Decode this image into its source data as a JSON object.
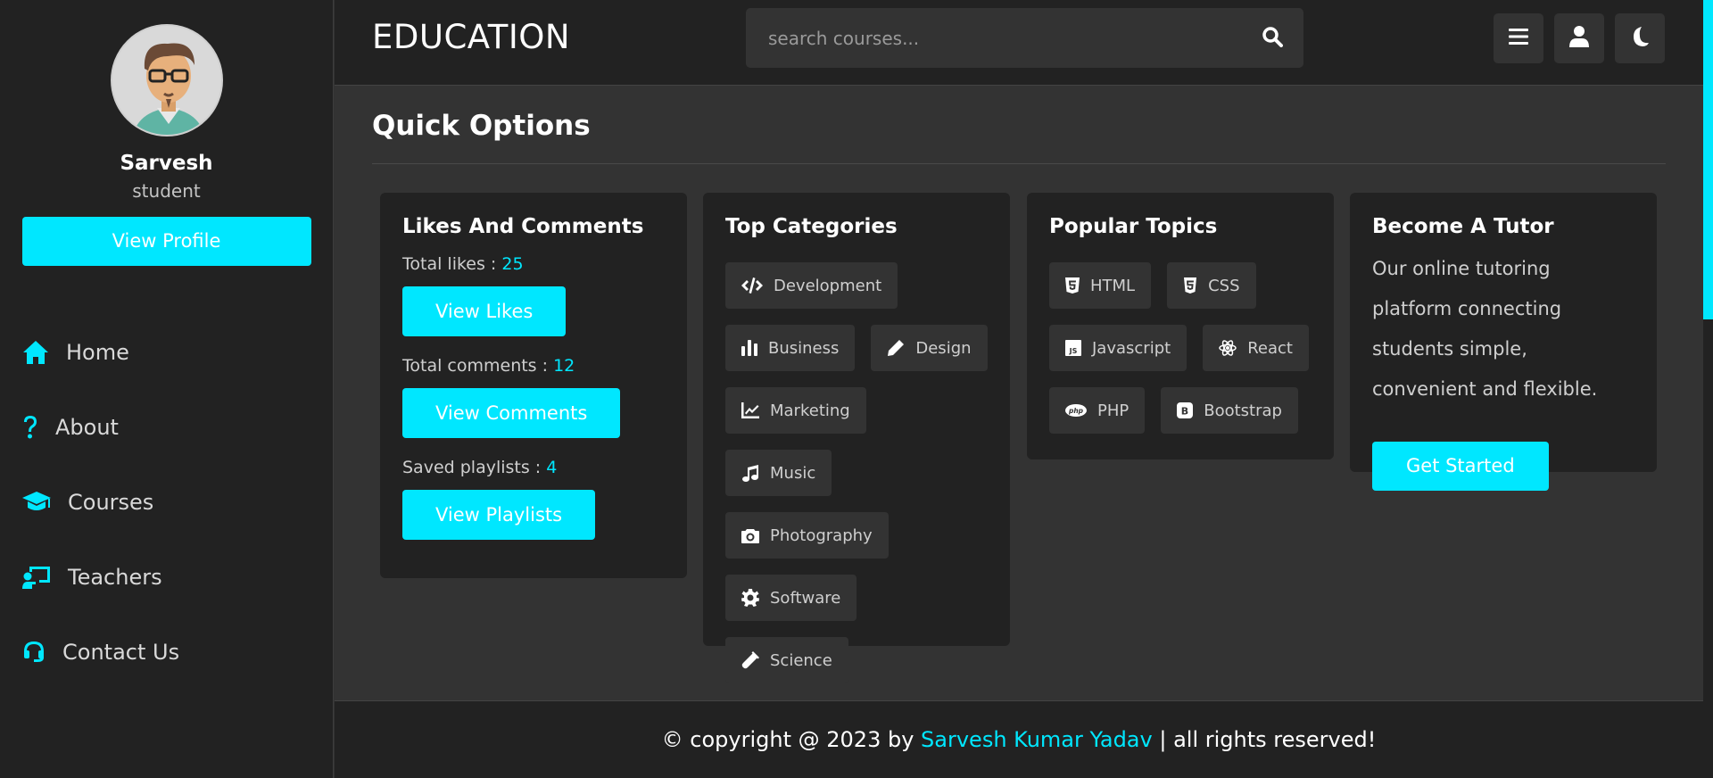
{
  "sidebar": {
    "profile": {
      "name": "Sarvesh",
      "role": "student",
      "button": "View Profile"
    },
    "nav": [
      {
        "label": "Home",
        "icon": "home-icon"
      },
      {
        "label": "About",
        "icon": "question-icon"
      },
      {
        "label": "Courses",
        "icon": "graduation-cap-icon"
      },
      {
        "label": "Teachers",
        "icon": "chalkboard-teacher-icon"
      },
      {
        "label": "Contact Us",
        "icon": "headset-icon"
      }
    ]
  },
  "header": {
    "logo": "EDUCATION",
    "search": {
      "placeholder": "search courses...",
      "icon": "search-icon"
    },
    "icons": [
      "menu-icon",
      "user-icon",
      "moon-icon"
    ]
  },
  "main": {
    "title": "Quick Options",
    "likes_card": {
      "title": "Likes And Comments",
      "likes_label": "Total likes : ",
      "likes_value": "25",
      "likes_button": "View Likes",
      "comments_label": "Total comments : ",
      "comments_value": "12",
      "comments_button": "View Comments",
      "playlists_label": "Saved playlists : ",
      "playlists_value": "4",
      "playlists_button": "View Playlists"
    },
    "categories_card": {
      "title": "Top Categories",
      "tags": [
        {
          "label": "Development",
          "icon": "code-icon"
        },
        {
          "label": "Business",
          "icon": "chart-bar-icon"
        },
        {
          "label": "Design",
          "icon": "pen-icon"
        },
        {
          "label": "Marketing",
          "icon": "chart-line-icon"
        },
        {
          "label": "Music",
          "icon": "music-icon"
        },
        {
          "label": "Photography",
          "icon": "camera-icon"
        },
        {
          "label": "Software",
          "icon": "cog-icon"
        },
        {
          "label": "Science",
          "icon": "vial-icon"
        }
      ]
    },
    "topics_card": {
      "title": "Popular Topics",
      "tags": [
        {
          "label": "HTML",
          "icon": "html5-icon"
        },
        {
          "label": "CSS",
          "icon": "css3-icon"
        },
        {
          "label": "Javascript",
          "icon": "js-icon"
        },
        {
          "label": "React",
          "icon": "react-icon"
        },
        {
          "label": "PHP",
          "icon": "php-icon"
        },
        {
          "label": "Bootstrap",
          "icon": "bootstrap-icon"
        }
      ]
    },
    "tutor_card": {
      "title": "Become A Tutor",
      "text": "Our online tutoring platform connecting students simple, convenient and flexible.",
      "button": "Get Started"
    }
  },
  "footer": {
    "prefix": "© copyright @ 2023 by ",
    "author": "Sarvesh Kumar Yadav",
    "suffix": " | all rights reserved!"
  },
  "colors": {
    "accent": "#00e7ff",
    "background": "#333333",
    "panel": "#222222"
  }
}
